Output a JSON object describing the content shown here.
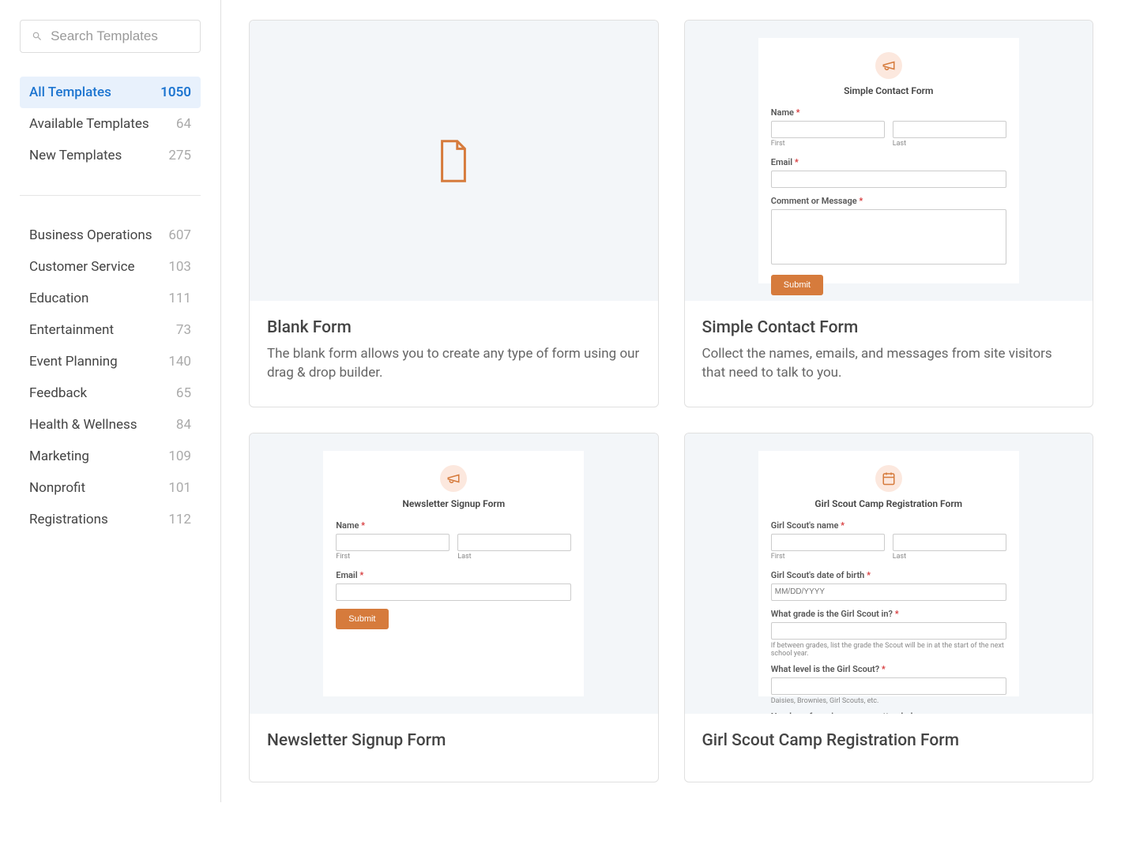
{
  "search": {
    "placeholder": "Search Templates"
  },
  "filters": [
    {
      "label": "All Templates",
      "count": "1050",
      "active": true
    },
    {
      "label": "Available Templates",
      "count": "64",
      "active": false
    },
    {
      "label": "New Templates",
      "count": "275",
      "active": false
    }
  ],
  "categories": [
    {
      "label": "Business Operations",
      "count": "607"
    },
    {
      "label": "Customer Service",
      "count": "103"
    },
    {
      "label": "Education",
      "count": "111"
    },
    {
      "label": "Entertainment",
      "count": "73"
    },
    {
      "label": "Event Planning",
      "count": "140"
    },
    {
      "label": "Feedback",
      "count": "65"
    },
    {
      "label": "Health & Wellness",
      "count": "84"
    },
    {
      "label": "Marketing",
      "count": "109"
    },
    {
      "label": "Nonprofit",
      "count": "101"
    },
    {
      "label": "Registrations",
      "count": "112"
    }
  ],
  "templates": [
    {
      "title": "Blank Form",
      "desc": "The blank form allows you to create any type of form using our drag & drop builder.",
      "preview": "blank"
    },
    {
      "title": "Simple Contact Form",
      "desc": "Collect the names, emails, and messages from site visitors that need to talk to you.",
      "preview": "contact",
      "form": {
        "icon": "megaphone",
        "heading": "Simple Contact Form",
        "name_label": "Name",
        "first": "First",
        "last": "Last",
        "email_label": "Email",
        "comment_label": "Comment or Message",
        "submit": "Submit"
      }
    },
    {
      "title": "Newsletter Signup Form",
      "desc": "",
      "preview": "newsletter",
      "form": {
        "icon": "megaphone",
        "heading": "Newsletter Signup Form",
        "name_label": "Name",
        "first": "First",
        "last": "Last",
        "email_label": "Email",
        "submit": "Submit"
      }
    },
    {
      "title": "Girl Scout Camp Registration Form",
      "desc": "",
      "preview": "girlscout",
      "form": {
        "icon": "calendar",
        "heading": "Girl Scout Camp Registration Form",
        "name_label": "Girl Scout's name",
        "first": "First",
        "last": "Last",
        "dob_label": "Girl Scout's date of birth",
        "dob_placeholder": "MM/DD/YYYY",
        "grade_label": "What grade is the Girl Scout in?",
        "grade_hint": "If between grades, list the grade the Scout will be in at the start of the next school year.",
        "level_label": "What level is the Girl Scout?",
        "level_hint": "Daisies, Brownies, Girl Scouts, etc.",
        "camps_label": "Number of previous camps attended"
      }
    }
  ]
}
